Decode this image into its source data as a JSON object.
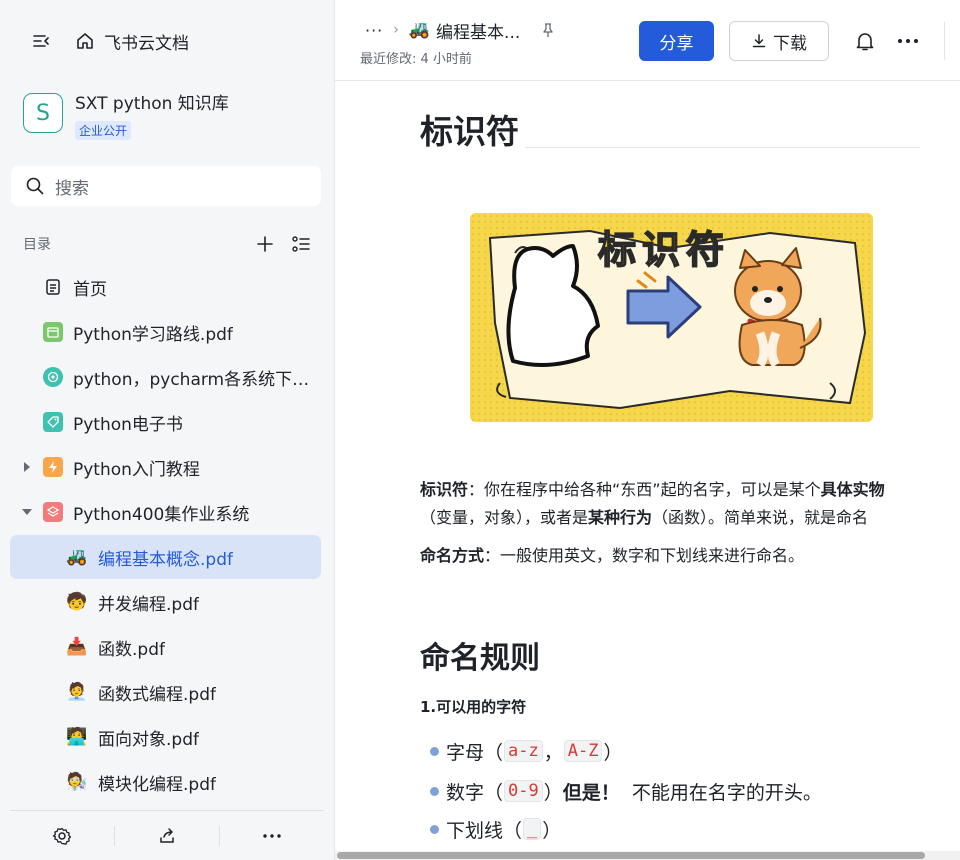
{
  "sidebar": {
    "app_name": "飞书云文档",
    "space": {
      "logo_letter": "S",
      "title": "SXT python 知识库",
      "badge": "企业公开"
    },
    "search_placeholder": "搜索",
    "toc_label": "目录",
    "items": [
      {
        "label": "首页",
        "icon": "doc-icon"
      },
      {
        "label": "Python学习路线.pdf",
        "icon": "green-calendar-icon"
      },
      {
        "label": "python，pycharm各系统下载安装",
        "icon": "teal-target-icon"
      },
      {
        "label": "Python电子书",
        "icon": "teal-tag-icon"
      },
      {
        "label": "Python入门教程",
        "icon": "orange-lightning-icon",
        "expandable": true,
        "expanded": false
      },
      {
        "label": "Python400集作业系统",
        "icon": "red-layers-icon",
        "expandable": true,
        "expanded": true
      },
      {
        "label": "编程基本概念.pdf",
        "emoji": "🚜",
        "active": true
      },
      {
        "label": "并发编程.pdf",
        "emoji": "🧒"
      },
      {
        "label": "函数.pdf",
        "emoji": "📥"
      },
      {
        "label": "函数式编程.pdf",
        "emoji": "🧑‍💼"
      },
      {
        "label": "面向对象.pdf",
        "emoji": "🧑‍💻"
      },
      {
        "label": "模块化编程.pdf",
        "emoji": "🧑‍🔬"
      }
    ]
  },
  "header": {
    "breadcrumb_more": "···",
    "doc_emoji": "🚜",
    "doc_title": "编程基本...",
    "modified": "最近修改: 4 小时前",
    "share_label": "分享",
    "download_label": "下载"
  },
  "doc": {
    "title": "标识符",
    "illustration_text": "标识符",
    "p1_term": "标识符",
    "p1_text_a": "：你在程序中给各种“东西”起的名字，可以是某个",
    "p1_bold_b": "具体实物",
    "p2_text_a": "（变量，对象），或者是",
    "p2_bold_b": "某种行为",
    "p2_text_c": "（函数）。简单来说，就是命名",
    "p3_term": "命名方式",
    "p3_text": "：一般使用英文，数字和下划线来进行命名。",
    "h2": "命名规则",
    "h3": "1.可以用的字符",
    "list": {
      "li1_pre": "字母（",
      "li1_code1": "a-z",
      "li1_sep": "，",
      "li1_code2": "A-Z",
      "li1_post": "）",
      "li2_pre": "数字（",
      "li2_code": "0-9",
      "li2_post": "）",
      "li2_bold": "但是！",
      "li2_rest": "  不能用在名字的开头。",
      "li3_pre": "下划线（",
      "li3_code": "_",
      "li3_post": "）"
    }
  },
  "colors": {
    "accent": "#245bdb",
    "active_bg": "#d9e3f8",
    "sidebar_bg": "#f5f6f7",
    "code_red": "#d83931"
  }
}
